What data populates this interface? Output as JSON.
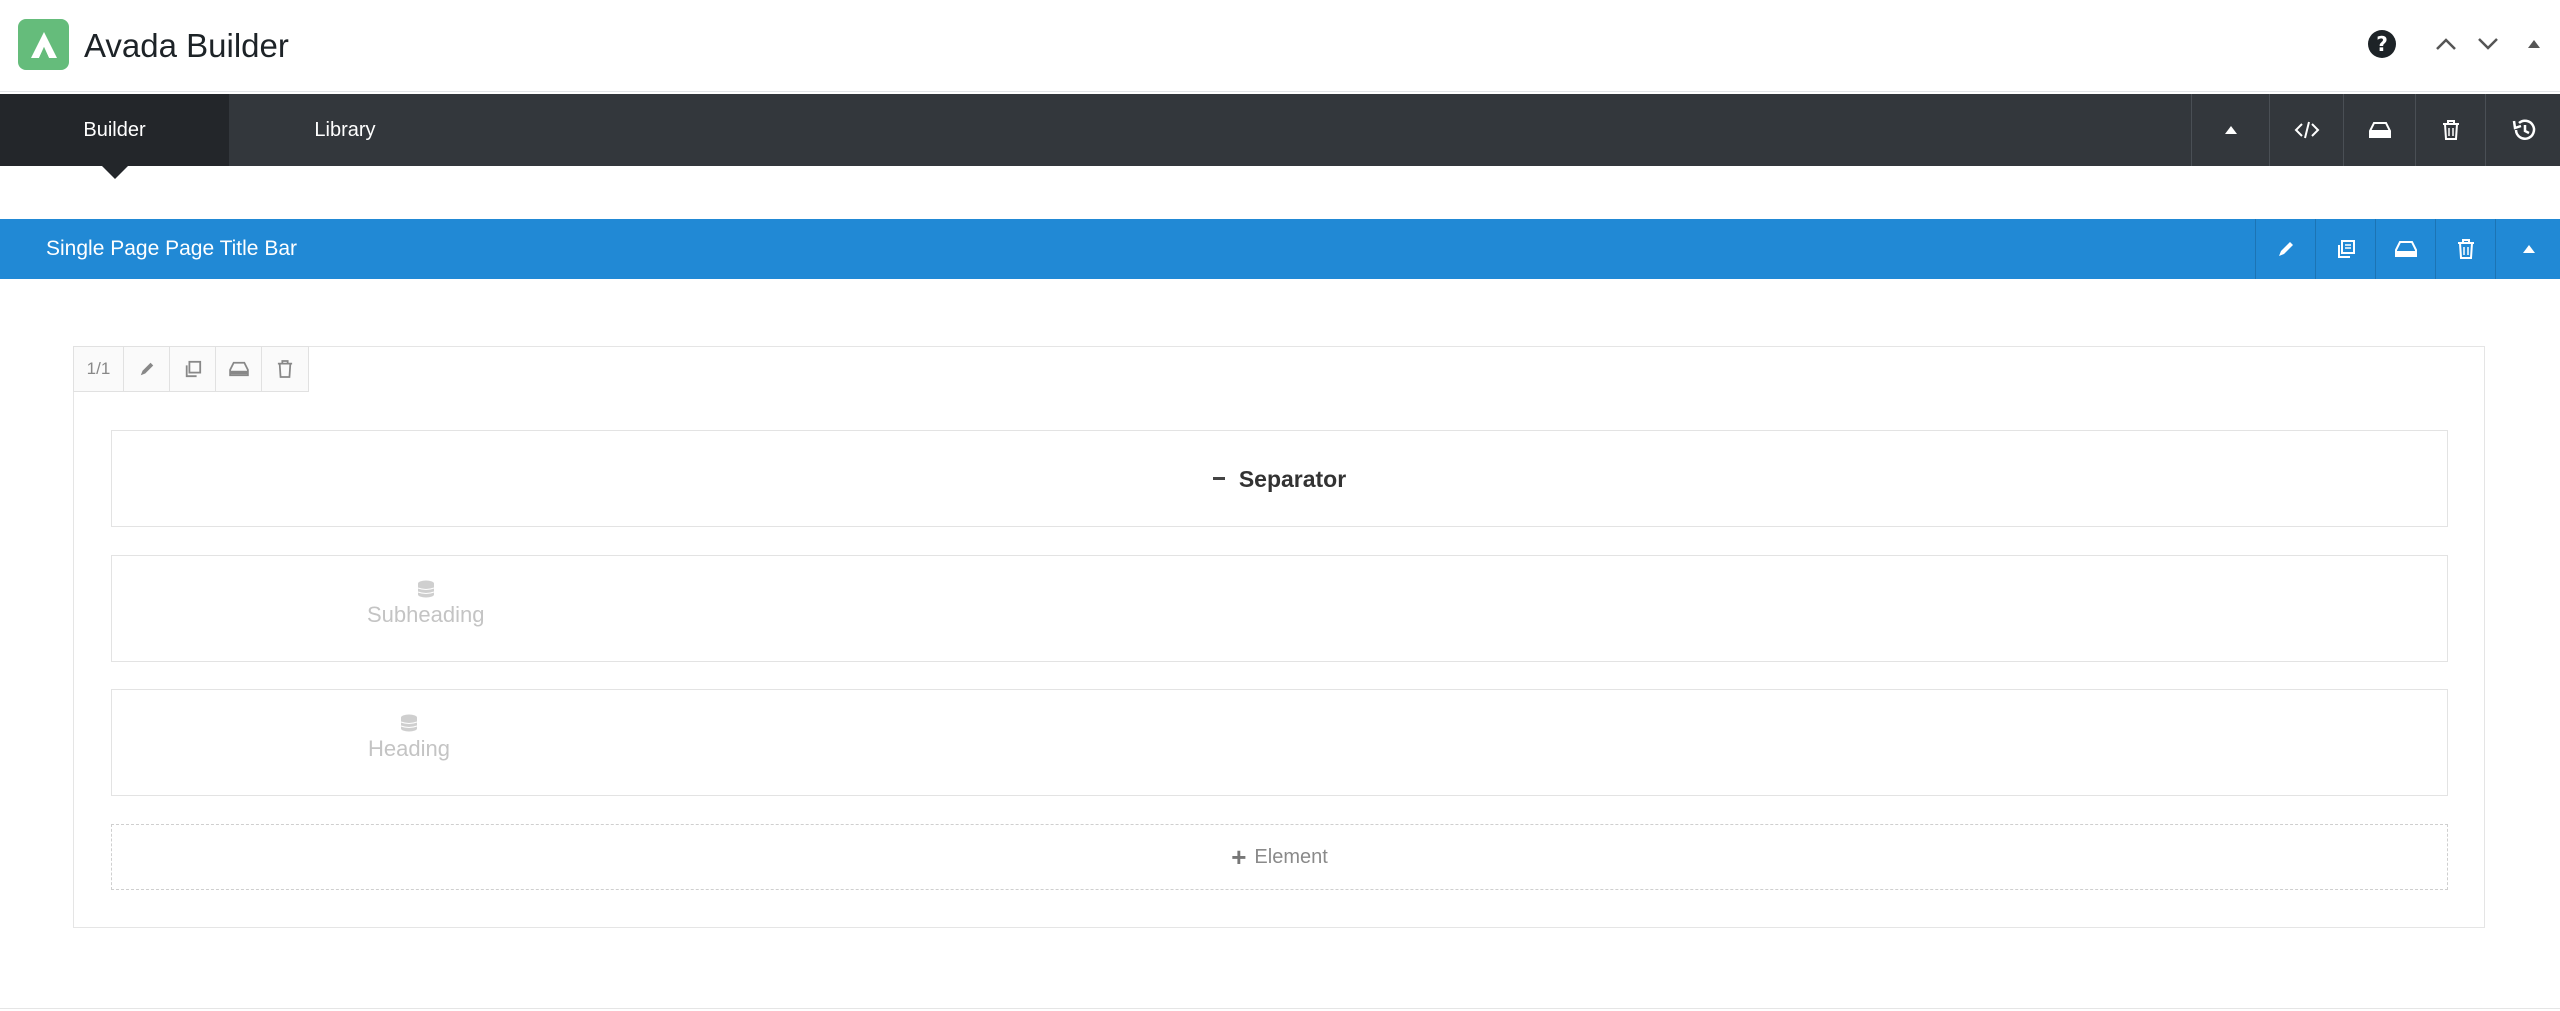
{
  "header": {
    "title": "Avada Builder",
    "icons": [
      "avada-logo-icon",
      "help-icon",
      "chevron-up-icon",
      "chevron-down-icon",
      "triangle-up-icon"
    ]
  },
  "tabs": [
    {
      "label": "Builder",
      "active": true
    },
    {
      "label": "Library",
      "active": false
    }
  ],
  "toolbar": {
    "icons": [
      "collapse-icon",
      "code-icon",
      "save-icon",
      "trash-icon",
      "history-icon"
    ]
  },
  "container": {
    "title": "Single Page Page Title Bar",
    "color": "#2189d5",
    "icons": [
      "pencil-icon",
      "clone-icon",
      "save-icon",
      "trash-icon",
      "collapse-icon"
    ]
  },
  "column": {
    "size": "1/1",
    "icons": [
      "pencil-icon",
      "clone-icon",
      "save-icon",
      "trash-icon"
    ]
  },
  "elements": [
    {
      "type": "separator",
      "label": "Separator"
    },
    {
      "type": "dynamic",
      "label": "Subheading",
      "icon": "database-icon"
    },
    {
      "type": "dynamic",
      "label": "Heading",
      "icon": "database-icon"
    }
  ],
  "add_element": {
    "label": "Element"
  },
  "colors": {
    "logo": "#65bc7b",
    "tabbar": "#33373c",
    "tab_active": "#23262a",
    "container_bar": "#2189d5"
  }
}
